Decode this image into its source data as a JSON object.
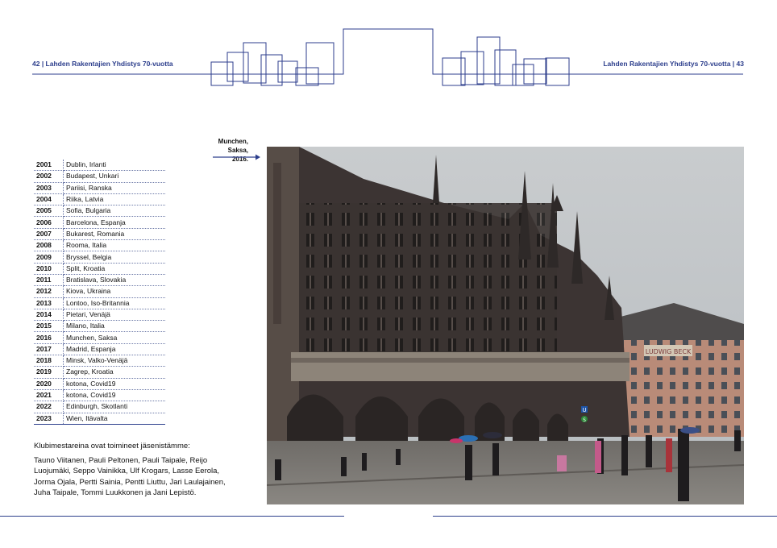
{
  "header": {
    "left": "42 | Lahden Rakentajien Yhdistys 70-vuotta",
    "right": "Lahden Rakentajien Yhdistys 70-vuotta | 43"
  },
  "photo": {
    "caption": "Munchen, Saksa, 2016.",
    "signs": [
      "LUDWIG BECK",
      "U",
      "S"
    ]
  },
  "years": [
    {
      "year": "2001",
      "city": "Dublin, Irlanti"
    },
    {
      "year": "2002",
      "city": "Budapest, Unkari"
    },
    {
      "year": "2003",
      "city": "Pariisi, Ranska"
    },
    {
      "year": "2004",
      "city": "Riika, Latvia"
    },
    {
      "year": "2005",
      "city": "Sofia, Bulgaria"
    },
    {
      "year": "2006",
      "city": "Barcelona, Espanja"
    },
    {
      "year": "2007",
      "city": "Bukarest, Romania"
    },
    {
      "year": "2008",
      "city": "Rooma, Italia"
    },
    {
      "year": "2009",
      "city": "Bryssel, Belgia"
    },
    {
      "year": "2010",
      "city": "Split, Kroatia"
    },
    {
      "year": "2011",
      "city": "Bratislava, Slovakia"
    },
    {
      "year": "2012",
      "city": "Kiova, Ukraina"
    },
    {
      "year": "2013",
      "city": "Lontoo, Iso-Britannia"
    },
    {
      "year": "2014",
      "city": "Pietari, Venäjä"
    },
    {
      "year": "2015",
      "city": "Milano, Italia"
    },
    {
      "year": "2016",
      "city": "Munchen, Saksa"
    },
    {
      "year": "2017",
      "city": "Madrid, Espanja"
    },
    {
      "year": "2018",
      "city": "Minsk, Valko-Venäjä"
    },
    {
      "year": "2019",
      "city": "Zagrep, Kroatia"
    },
    {
      "year": "2020",
      "city": "kotona, Covid19"
    },
    {
      "year": "2021",
      "city": "kotona, Covid19"
    },
    {
      "year": "2022",
      "city": "Edinburgh, Skotlanti"
    },
    {
      "year": "2023",
      "city": "Wien, Itävalta"
    }
  ],
  "champions": {
    "title": "Klubimestareina ovat toimineet jäsenistämme:",
    "names": "Tauno Viitanen, Pauli Peltonen, Pauli Taipale, Reijo Luojumäki, Seppo Vainikka, Ulf Krogars, Lasse Eerola, Jorma Ojala, Pertti Sainia, Pentti Liuttu, Jari Laulajainen, Juha Taipale, Tommi Luukkonen ja Jani Lepistö."
  },
  "colors": {
    "accent": "#2c3e8c"
  }
}
